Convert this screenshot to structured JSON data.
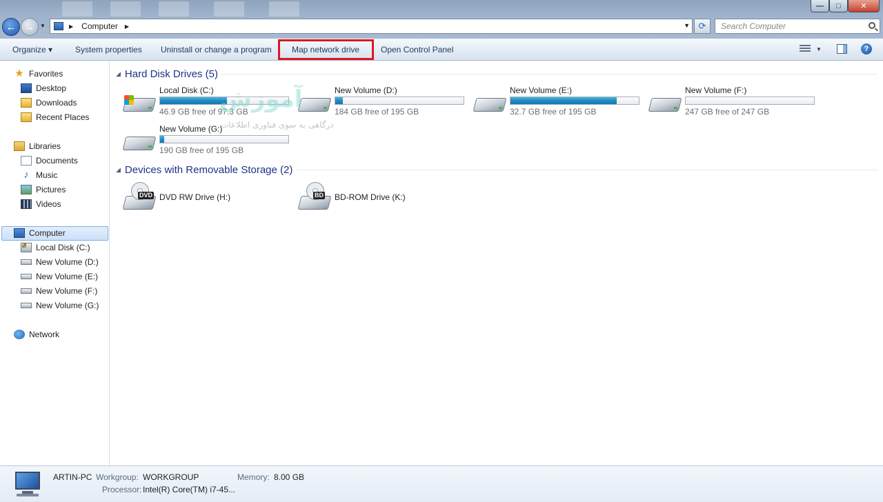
{
  "window": {
    "minimize_glyph": "—",
    "maximize_glyph": "□",
    "close_glyph": "✕"
  },
  "address": {
    "crumb": "Computer",
    "search_placeholder": "Search Computer"
  },
  "commands": {
    "organize": "Organize ▾",
    "system_properties": "System properties",
    "uninstall": "Uninstall or change a program",
    "map_network_drive": "Map network drive",
    "open_control_panel": "Open Control Panel",
    "highlight_color": "#e0161e"
  },
  "nav": {
    "favorites": "Favorites",
    "desktop": "Desktop",
    "downloads": "Downloads",
    "recent_places": "Recent Places",
    "libraries": "Libraries",
    "documents": "Documents",
    "music": "Music",
    "pictures": "Pictures",
    "videos": "Videos",
    "computer": "Computer",
    "drive_c": "Local Disk (C:)",
    "drive_d": "New Volume (D:)",
    "drive_e": "New Volume (E:)",
    "drive_f": "New Volume (F:)",
    "drive_g": "New Volume (G:)",
    "network": "Network"
  },
  "hard_disks": {
    "header": "Hard Disk Drives (5)",
    "drives": [
      {
        "name": "Local Disk (C:)",
        "free": "46.9 GB free of 97.3 GB",
        "used_fraction": 0.52,
        "system": true
      },
      {
        "name": "New Volume (D:)",
        "free": "184 GB free of 195 GB",
        "used_fraction": 0.06
      },
      {
        "name": "New Volume (E:)",
        "free": "32.7 GB free of 195 GB",
        "used_fraction": 0.83
      },
      {
        "name": "New Volume (F:)",
        "free": "247 GB free of 247 GB",
        "used_fraction": 0.0
      },
      {
        "name": "New Volume (G:)",
        "free": "190 GB free of 195 GB",
        "used_fraction": 0.03
      }
    ]
  },
  "removable": {
    "header": "Devices with Removable Storage (2)",
    "devices": [
      {
        "name": "DVD RW Drive (H:)",
        "tag": "DVD"
      },
      {
        "name": "BD-ROM Drive (K:)",
        "tag": "BD"
      }
    ]
  },
  "watermark": {
    "brand": "آموزش",
    "tagline": "درگاهی به سوی فناوری اطلاعات"
  },
  "details": {
    "pc_name": "ARTIN-PC",
    "workgroup_label": "Workgroup:",
    "workgroup": "WORKGROUP",
    "memory_label": "Memory:",
    "memory": "8.00 GB",
    "processor_label": "Processor:",
    "processor": "Intel(R) Core(TM) i7-45..."
  }
}
